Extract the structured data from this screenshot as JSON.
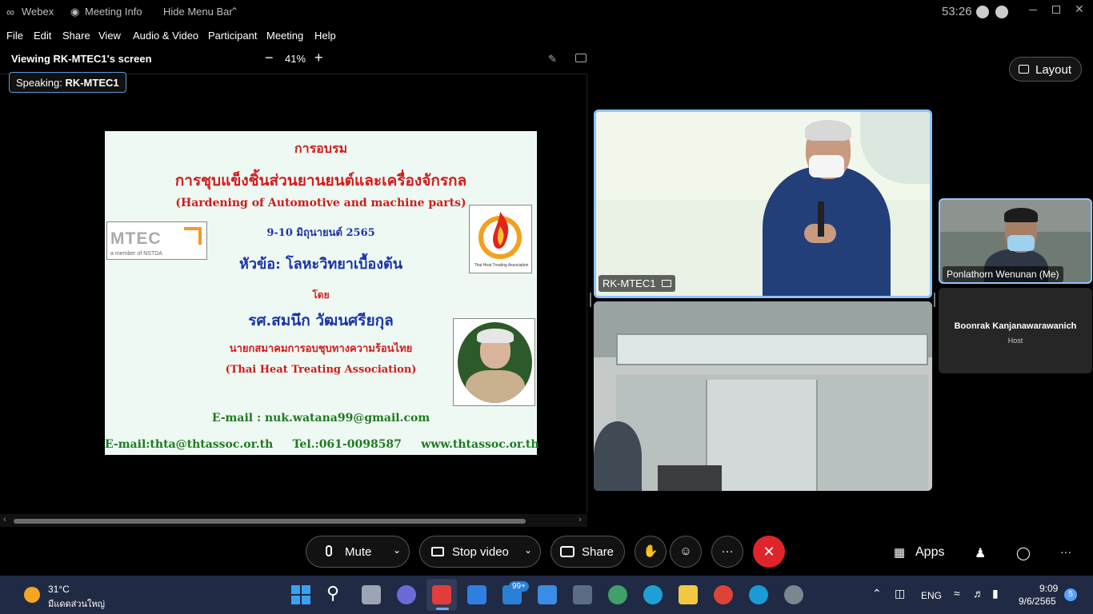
{
  "titlebar": {
    "app_name": "Webex",
    "meeting_info": "Meeting Info",
    "hide_menu": "Hide Menu Bar",
    "timer": "53:26"
  },
  "menu": [
    "File",
    "Edit",
    "Share",
    "View",
    "Audio & Video",
    "Participant",
    "Meeting",
    "Help"
  ],
  "share": {
    "viewing": "Viewing RK-MTEC1's screen",
    "zoom": "41%",
    "speaking_label": "Speaking:",
    "speaking_name": "RK-MTEC1"
  },
  "slide": {
    "line1": "การอบรม",
    "line2": "การชุบแข็งชิ้นส่วนยานยนต์และเครื่องจักรกล",
    "line3": "(Hardening of Automotive and machine parts)",
    "line4": "9-10 มิถุนายนต์ 2565",
    "line5": "หัวข้อ: โลหะวิทยาเบื้องต้น",
    "line6": "โดย",
    "line7": "รศ.สมนึก  วัฒนศรียกุล",
    "line8": "นายกสมาคมการอบชุบทางความร้อนไทย",
    "line9": "(Thai Heat Treating Association)",
    "line10": "E-mail : nuk.watana99@gmail.com",
    "line11": "E-mail:thta@thtassoc.or.th     Tel.:061-0098587     www.thtassoc.or.th",
    "mtec_logo_text": "MTEC",
    "mtec_sub": "a member of NSTDA",
    "tta_logo_text": "Thai Heat Treating Association"
  },
  "layout_label": "Layout",
  "participants": {
    "main_name": "RK-MTEC1",
    "me_name": "Ponlathorn Wenunan (Me)",
    "host_name": "Boonrak Kanjanawarawanich",
    "host_role": "Host"
  },
  "controls": {
    "mute": "Mute",
    "stop_video": "Stop video",
    "share": "Share",
    "apps": "Apps",
    "more": "···"
  },
  "taskbar": {
    "weather_temp": "31°C",
    "weather_desc": "มีแดดส่วนใหญ่",
    "mail_badge": "99+",
    "lang": "ENG",
    "time": "9:09",
    "date": "9/6/2565",
    "notification_count": "5"
  }
}
